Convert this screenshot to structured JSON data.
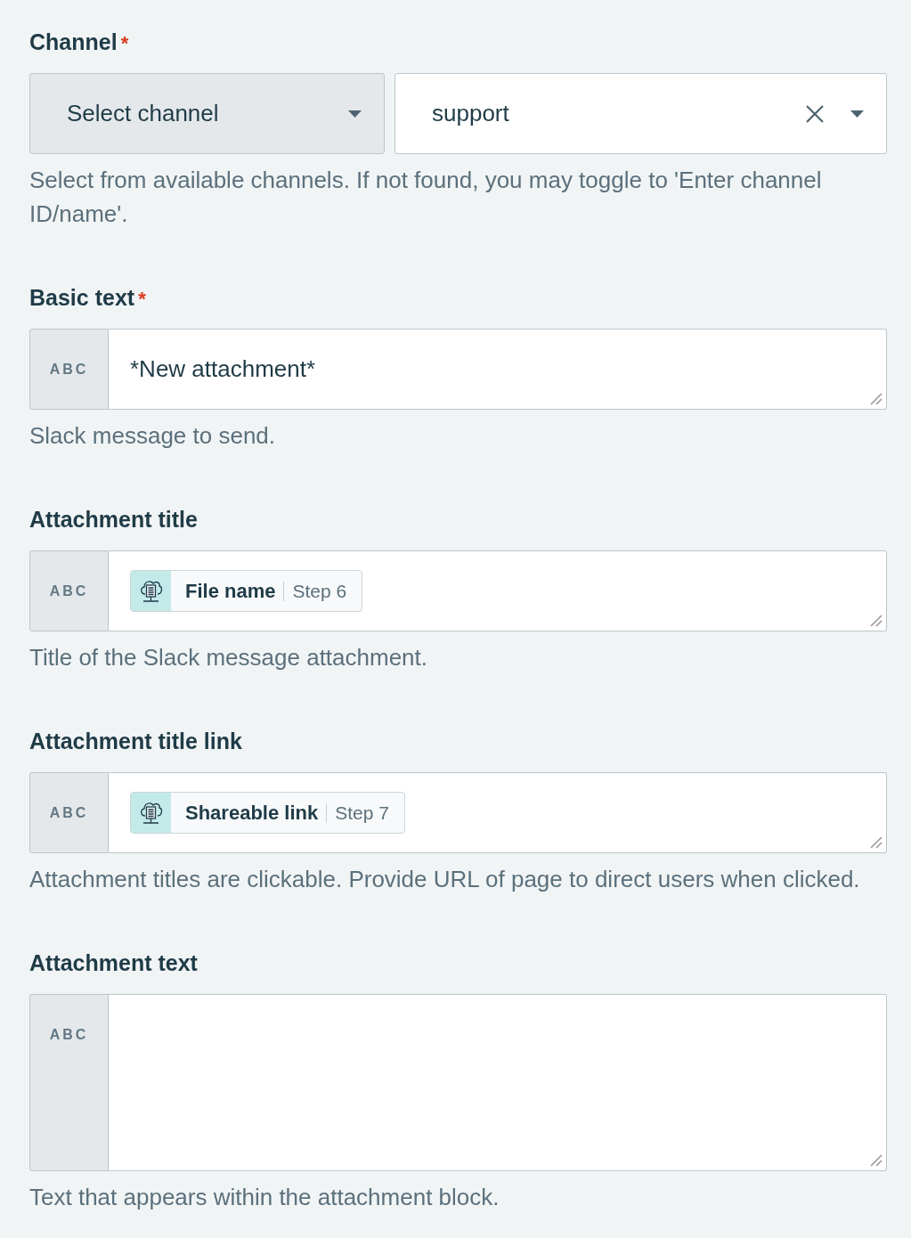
{
  "fields": [
    {
      "kind": "channel",
      "label": "Channel",
      "required_mark": "*",
      "mode_select": {
        "value": "Select channel"
      },
      "channel_select": {
        "value": "support"
      },
      "hint": "Select from available channels. If not found, you may toggle to 'Enter channel ID/name'."
    },
    {
      "kind": "text",
      "label": "Basic text",
      "required_mark": "*",
      "type_badge": "ABC",
      "value": "*New attachment*",
      "hint": "Slack message to send."
    },
    {
      "kind": "text",
      "label": "Attachment title",
      "type_badge": "ABC",
      "pills": [
        {
          "name": "File name",
          "step": "Step 6"
        }
      ],
      "hint": "Title of the Slack message attachment."
    },
    {
      "kind": "text",
      "label": "Attachment title link",
      "type_badge": "ABC",
      "pills": [
        {
          "name": "Shareable link",
          "step": "Step 7"
        }
      ],
      "hint": "Attachment titles are clickable. Provide URL of page to direct users when clicked."
    },
    {
      "kind": "multiline",
      "label": "Attachment text",
      "type_badge": "ABC",
      "hint": "Text that appears within the attachment block."
    }
  ]
}
